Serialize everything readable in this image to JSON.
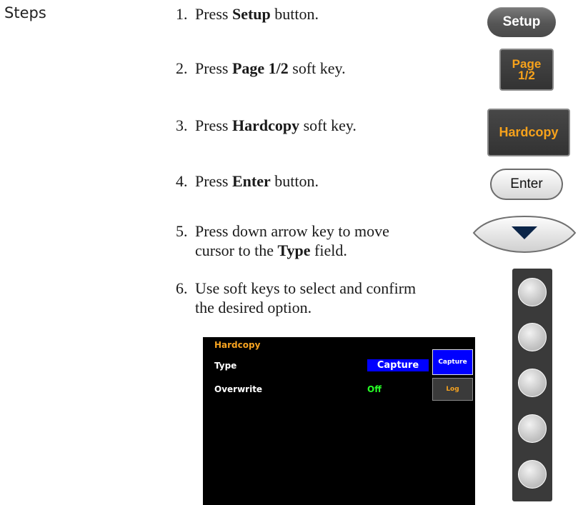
{
  "section_label": "Steps",
  "steps": [
    {
      "num": "1.",
      "pre": "Press ",
      "bold": "Setup",
      "post": " button."
    },
    {
      "num": "2.",
      "pre": "Press ",
      "bold": "Page 1/2",
      "post": " soft key."
    },
    {
      "num": "3.",
      "pre": "Press ",
      "bold": "Hardcopy",
      "post": " soft key."
    },
    {
      "num": "4.",
      "pre": "Press ",
      "bold": "Enter",
      "post": " button."
    },
    {
      "num": "5.",
      "line1": "Press down arrow key to move",
      "line2_pre": "cursor to the ",
      "bold": "Type",
      "post": " field."
    },
    {
      "num": "6.",
      "line1": "Use soft keys to select and confirm",
      "line2": "the desired option."
    }
  ],
  "buttons": {
    "setup": "Setup",
    "page": "Page\n1/2",
    "hardcopy": "Hardcopy",
    "enter": "Enter",
    "down_arrow": "down-arrow"
  },
  "screen": {
    "title": "Hardcopy",
    "type_label": "Type",
    "type_value": "Capture",
    "overwrite_label": "Overwrite",
    "overwrite_value": "Off",
    "softkeys": [
      "Capture",
      "Log"
    ]
  },
  "colors": {
    "accent_orange": "#f6a320",
    "highlight_blue": "#0000ff",
    "value_green": "#26ff26"
  }
}
